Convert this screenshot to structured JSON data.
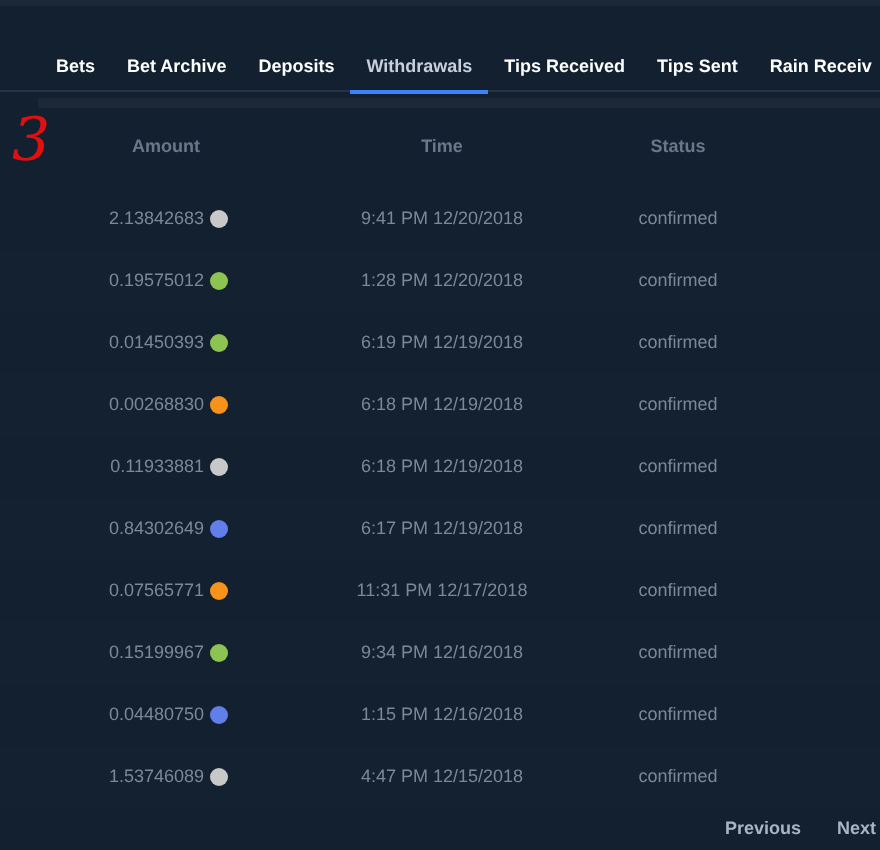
{
  "tabs": [
    {
      "label": "Bets",
      "selected": false
    },
    {
      "label": "Bet Archive",
      "selected": false
    },
    {
      "label": "Deposits",
      "selected": false
    },
    {
      "label": "Withdrawals",
      "selected": true
    },
    {
      "label": "Tips Received",
      "selected": false
    },
    {
      "label": "Tips Sent",
      "selected": false
    },
    {
      "label": "Rain Receiv",
      "selected": false
    }
  ],
  "annotation": "3",
  "table": {
    "columns": [
      "Amount",
      "Time",
      "Status"
    ],
    "rows": [
      {
        "amount": "2.13842683",
        "color": "#c8c8c8",
        "time": "9:41 PM 12/20/2018",
        "status": "confirmed"
      },
      {
        "amount": "0.19575012",
        "color": "#8dc351",
        "time": "1:28 PM 12/20/2018",
        "status": "confirmed"
      },
      {
        "amount": "0.01450393",
        "color": "#8dc351",
        "time": "6:19 PM 12/19/2018",
        "status": "confirmed"
      },
      {
        "amount": "0.00268830",
        "color": "#f7931a",
        "time": "6:18 PM 12/19/2018",
        "status": "confirmed"
      },
      {
        "amount": "0.11933881",
        "color": "#c8c8c8",
        "time": "6:18 PM 12/19/2018",
        "status": "confirmed"
      },
      {
        "amount": "0.84302649",
        "color": "#627eea",
        "time": "6:17 PM 12/19/2018",
        "status": "confirmed"
      },
      {
        "amount": "0.07565771",
        "color": "#f7931a",
        "time": "11:31 PM 12/17/2018",
        "status": "confirmed"
      },
      {
        "amount": "0.15199967",
        "color": "#8dc351",
        "time": "9:34 PM 12/16/2018",
        "status": "confirmed"
      },
      {
        "amount": "0.04480750",
        "color": "#627eea",
        "time": "1:15 PM 12/16/2018",
        "status": "confirmed"
      },
      {
        "amount": "1.53746089",
        "color": "#c8c8c8",
        "time": "4:47 PM 12/15/2018",
        "status": "confirmed"
      }
    ]
  },
  "pagination": [
    "Previous",
    "Next"
  ]
}
